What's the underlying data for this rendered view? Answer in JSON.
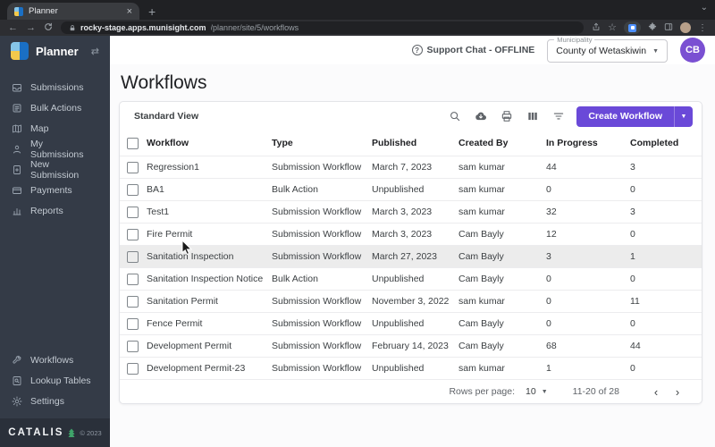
{
  "browser": {
    "tab_title": "Planner",
    "new_tab_label": "+",
    "close_label": "×",
    "url_host": "rocky-stage.apps.munisight.com",
    "url_path": "/planner/site/5/workflows"
  },
  "sidebar": {
    "brand": "Planner",
    "items": [
      {
        "label": "Submissions",
        "icon": "inbox-icon"
      },
      {
        "label": "Bulk Actions",
        "icon": "list-icon"
      },
      {
        "label": "Map",
        "icon": "map-icon"
      },
      {
        "label": "My Submissions",
        "icon": "person-icon"
      },
      {
        "label": "New Submission",
        "icon": "document-plus-icon"
      },
      {
        "label": "Payments",
        "icon": "credit-card-icon"
      },
      {
        "label": "Reports",
        "icon": "bar-chart-icon"
      }
    ],
    "bottom_items": [
      {
        "label": "Workflows",
        "icon": "wrench-icon"
      },
      {
        "label": "Lookup Tables",
        "icon": "document-search-icon"
      },
      {
        "label": "Settings",
        "icon": "gear-icon"
      }
    ],
    "footer_brand": "CATALIS",
    "footer_copyright": "© 2023"
  },
  "header": {
    "support_chat": "Support Chat - OFFLINE",
    "municipality_label": "Municipality",
    "municipality_value": "County of Wetaskiwin",
    "avatar_initials": "CB"
  },
  "main": {
    "page_title": "Workflows",
    "view_selector": "Standard View",
    "create_button": "Create Workflow"
  },
  "table": {
    "columns": [
      "Workflow",
      "Type",
      "Published",
      "Created By",
      "In Progress",
      "Completed"
    ],
    "highlighted_index": 4,
    "rows": [
      {
        "workflow": "Regression1",
        "type": "Submission Workflow",
        "published": "March 7, 2023",
        "created_by": "sam kumar",
        "in_progress": "44",
        "completed": "3"
      },
      {
        "workflow": "BA1",
        "type": "Bulk Action",
        "published": "Unpublished",
        "created_by": "sam kumar",
        "in_progress": "0",
        "completed": "0"
      },
      {
        "workflow": "Test1",
        "type": "Submission Workflow",
        "published": "March 3, 2023",
        "created_by": "sam kumar",
        "in_progress": "32",
        "completed": "3"
      },
      {
        "workflow": "Fire Permit",
        "type": "Submission Workflow",
        "published": "March 3, 2023",
        "created_by": "Cam Bayly",
        "in_progress": "12",
        "completed": "0"
      },
      {
        "workflow": "Sanitation Inspection",
        "type": "Submission Workflow",
        "published": "March 27, 2023",
        "created_by": "Cam Bayly",
        "in_progress": "3",
        "completed": "1"
      },
      {
        "workflow": "Sanitation Inspection Notice",
        "type": "Bulk Action",
        "published": "Unpublished",
        "created_by": "Cam Bayly",
        "in_progress": "0",
        "completed": "0"
      },
      {
        "workflow": "Sanitation Permit",
        "type": "Submission Workflow",
        "published": "November 3, 2022",
        "created_by": "sam kumar",
        "in_progress": "0",
        "completed": "11"
      },
      {
        "workflow": "Fence Permit",
        "type": "Submission Workflow",
        "published": "Unpublished",
        "created_by": "Cam Bayly",
        "in_progress": "0",
        "completed": "0"
      },
      {
        "workflow": "Development Permit",
        "type": "Submission Workflow",
        "published": "February 14, 2023",
        "created_by": "Cam Bayly",
        "in_progress": "68",
        "completed": "44"
      },
      {
        "workflow": "Development Permit-23",
        "type": "Submission Workflow",
        "published": "Unpublished",
        "created_by": "sam kumar",
        "in_progress": "1",
        "completed": "0"
      }
    ]
  },
  "pagination": {
    "rows_per_page_label": "Rows per page:",
    "rows_per_page_value": "10",
    "range_text": "11-20 of 28",
    "prev_label": "‹",
    "next_label": "›"
  },
  "colors": {
    "accent_purple": "#6a49d8",
    "avatar_purple": "#7a50d2",
    "sidebar_bg": "#343b47",
    "sidebar_footer_bg": "#2a303a",
    "chrome_bg": "#202124",
    "highlight_row": "#ececec",
    "catalis_green": "#3fa46a"
  }
}
